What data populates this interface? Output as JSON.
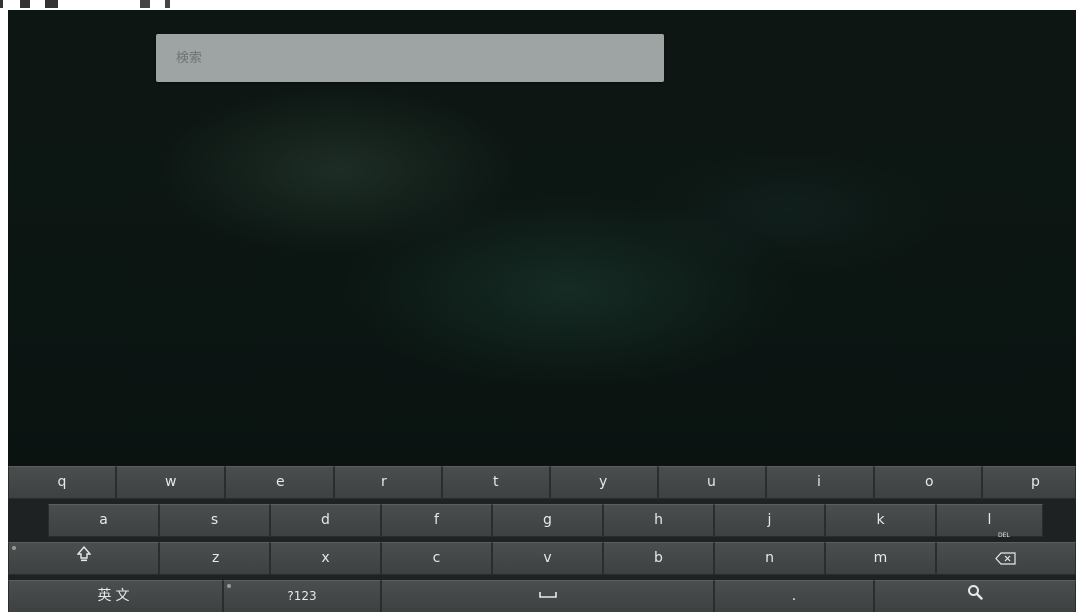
{
  "search": {
    "placeholder": "検索"
  },
  "keyboard": {
    "row1": [
      "q",
      "w",
      "e",
      "r",
      "t",
      "y",
      "u",
      "i",
      "o",
      "p"
    ],
    "row2": [
      "a",
      "s",
      "d",
      "f",
      "g",
      "h",
      "j",
      "k",
      "l"
    ],
    "row3": [
      "z",
      "x",
      "c",
      "v",
      "b",
      "n",
      "m"
    ],
    "lang_label": "英文",
    "symbols_label": "?123",
    "period_label": ".",
    "del_label": "DEL",
    "icons": {
      "shift": "shift-icon",
      "delete": "backspace-icon",
      "space": "space-icon",
      "search": "search-icon"
    }
  }
}
